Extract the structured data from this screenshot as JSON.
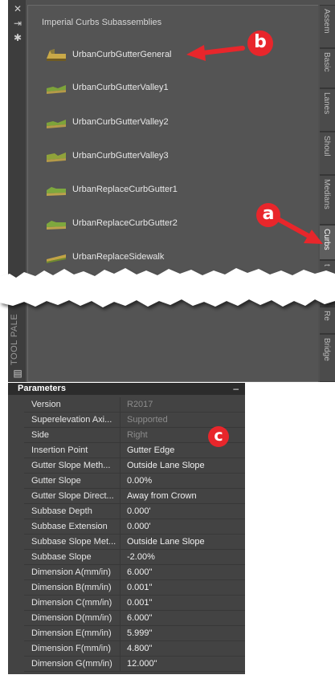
{
  "tool_palette": {
    "heading": "Imperial Curbs Subassemblies",
    "vertical_title": "TOOL PALE",
    "items": [
      {
        "label": "UrbanCurbGutterGeneral",
        "icon": "curb-general-icon"
      },
      {
        "label": "UrbanCurbGutterValley1",
        "icon": "curb-valley-icon"
      },
      {
        "label": "UrbanCurbGutterValley2",
        "icon": "curb-valley-icon"
      },
      {
        "label": "UrbanCurbGutterValley3",
        "icon": "curb-valley-icon"
      },
      {
        "label": "UrbanReplaceCurbGutter1",
        "icon": "curb-replace-icon"
      },
      {
        "label": "UrbanReplaceCurbGutter2",
        "icon": "curb-replace-icon"
      },
      {
        "label": "UrbanReplaceSidewalk",
        "icon": "sidewalk-icon"
      }
    ],
    "tabs": [
      "Assem",
      "Basic",
      "Lanes",
      "Shoul",
      "Medians",
      "Curbs",
      "t",
      "Re",
      "Bridge"
    ],
    "active_tab": "Curbs"
  },
  "annotations": {
    "a": "a",
    "b": "b",
    "c": "c",
    "color": "#e8262b"
  },
  "parameters": {
    "title": "Parameters",
    "collapse": "–",
    "rows": [
      {
        "name": "Version",
        "value": "R2017",
        "readonly": true
      },
      {
        "name": "Superelevation Axi...",
        "value": "Supported",
        "readonly": true
      },
      {
        "name": "Side",
        "value": "Right",
        "readonly": true
      },
      {
        "name": "Insertion Point",
        "value": "Gutter Edge",
        "readonly": false
      },
      {
        "name": "Gutter Slope Meth...",
        "value": "Outside Lane Slope",
        "readonly": false
      },
      {
        "name": "Gutter Slope",
        "value": "0.00%",
        "readonly": false
      },
      {
        "name": "Gutter Slope Direct...",
        "value": "Away from Crown",
        "readonly": false
      },
      {
        "name": "Subbase Depth",
        "value": "0.000'",
        "readonly": false
      },
      {
        "name": "Subbase Extension",
        "value": "0.000'",
        "readonly": false
      },
      {
        "name": "Subbase Slope Met...",
        "value": "Outside Lane Slope",
        "readonly": false
      },
      {
        "name": "Subbase Slope",
        "value": "-2.00%",
        "readonly": false
      },
      {
        "name": "Dimension A(mm/in)",
        "value": "6.000\"",
        "readonly": false
      },
      {
        "name": "Dimension B(mm/in)",
        "value": "0.001\"",
        "readonly": false
      },
      {
        "name": "Dimension C(mm/in)",
        "value": "0.001\"",
        "readonly": false
      },
      {
        "name": "Dimension D(mm/in)",
        "value": "6.000\"",
        "readonly": false
      },
      {
        "name": "Dimension E(mm/in)",
        "value": "5.999\"",
        "readonly": false
      },
      {
        "name": "Dimension F(mm/in)",
        "value": "4.800\"",
        "readonly": false
      },
      {
        "name": "Dimension G(mm/in)",
        "value": "12.000\"",
        "readonly": false
      }
    ]
  }
}
